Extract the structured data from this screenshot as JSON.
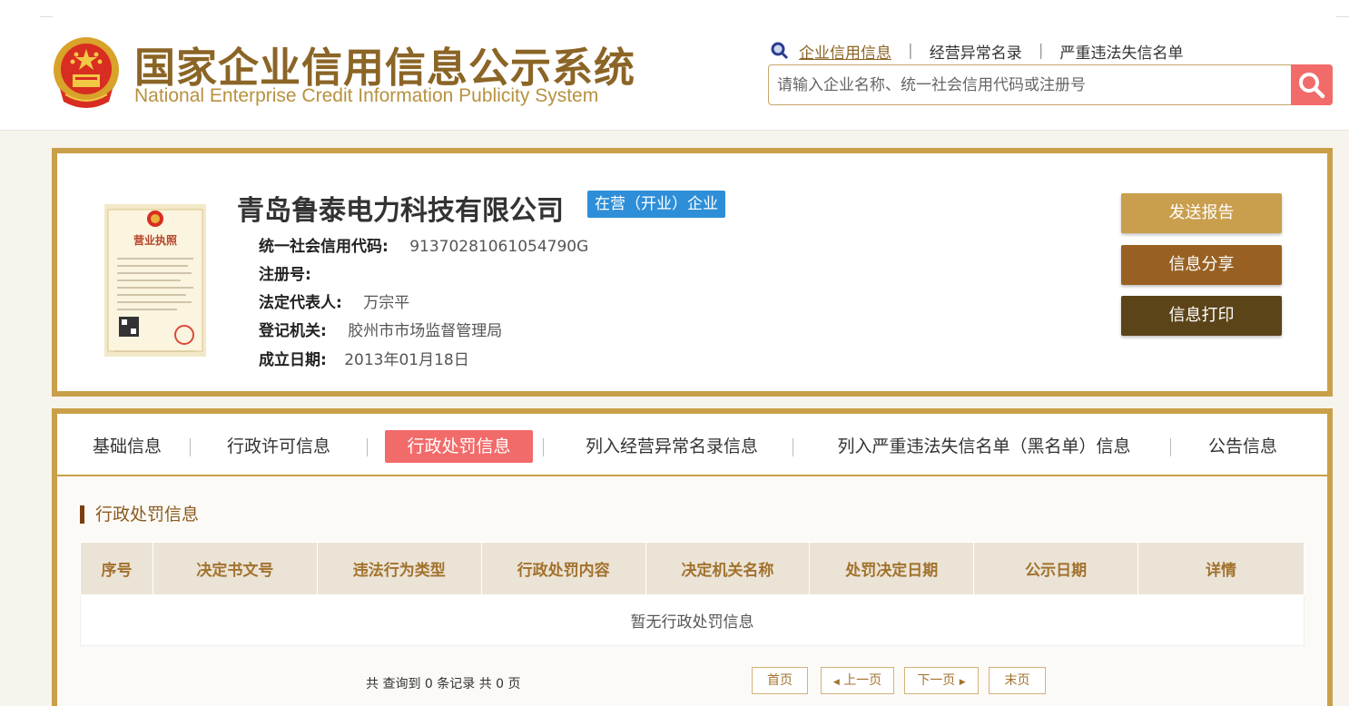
{
  "header": {
    "title_cn": "国家企业信用信息公示系统",
    "title_en": "National Enterprise Credit Information Publicity System",
    "nav": [
      {
        "label": "企业信用信息"
      },
      {
        "label": "经营异常名录"
      },
      {
        "label": "严重违法失信名单"
      }
    ],
    "search_placeholder": "请输入企业名称、统一社会信用代码或注册号"
  },
  "company": {
    "name": "青岛鲁泰电力科技有限公司",
    "status": "在营（开业）企业",
    "fields": [
      {
        "label": "统一社会信用代码:",
        "value": "91370281061054790G"
      },
      {
        "label": "注册号:",
        "value": ""
      },
      {
        "label": "法定代表人:",
        "value": "万宗平"
      },
      {
        "label": "登记机关:",
        "value": "胶州市市场监督管理局"
      },
      {
        "label": "成立日期:",
        "value": "2013年01月18日"
      }
    ],
    "license_title": "营业执照"
  },
  "actions": {
    "send_report": "发送报告",
    "share": "信息分享",
    "print": "信息打印"
  },
  "tabs": [
    {
      "label": "基础信息"
    },
    {
      "label": "行政许可信息"
    },
    {
      "label": "行政处罚信息"
    },
    {
      "label": "列入经营异常名录信息"
    },
    {
      "label": "列入严重违法失信名单（黑名单）信息"
    },
    {
      "label": "公告信息"
    }
  ],
  "section": {
    "title": "行政处罚信息",
    "columns": [
      "序号",
      "决定书文号",
      "违法行为类型",
      "行政处罚内容",
      "决定机关名称",
      "处罚决定日期",
      "公示日期",
      "详情"
    ],
    "empty_text": "暂无行政处罚信息"
  },
  "pager": {
    "summary": "共 查询到 0 条记录 共 0 页",
    "first": "首页",
    "prev": "上一页",
    "next": "下一页",
    "last": "末页"
  },
  "colors": {
    "gold": "#c9a049",
    "active_red": "#f26b6b",
    "status_blue": "#2e8fd8",
    "btn_report": "#c99e4d",
    "btn_share": "#986123",
    "btn_print": "#5c4419"
  }
}
